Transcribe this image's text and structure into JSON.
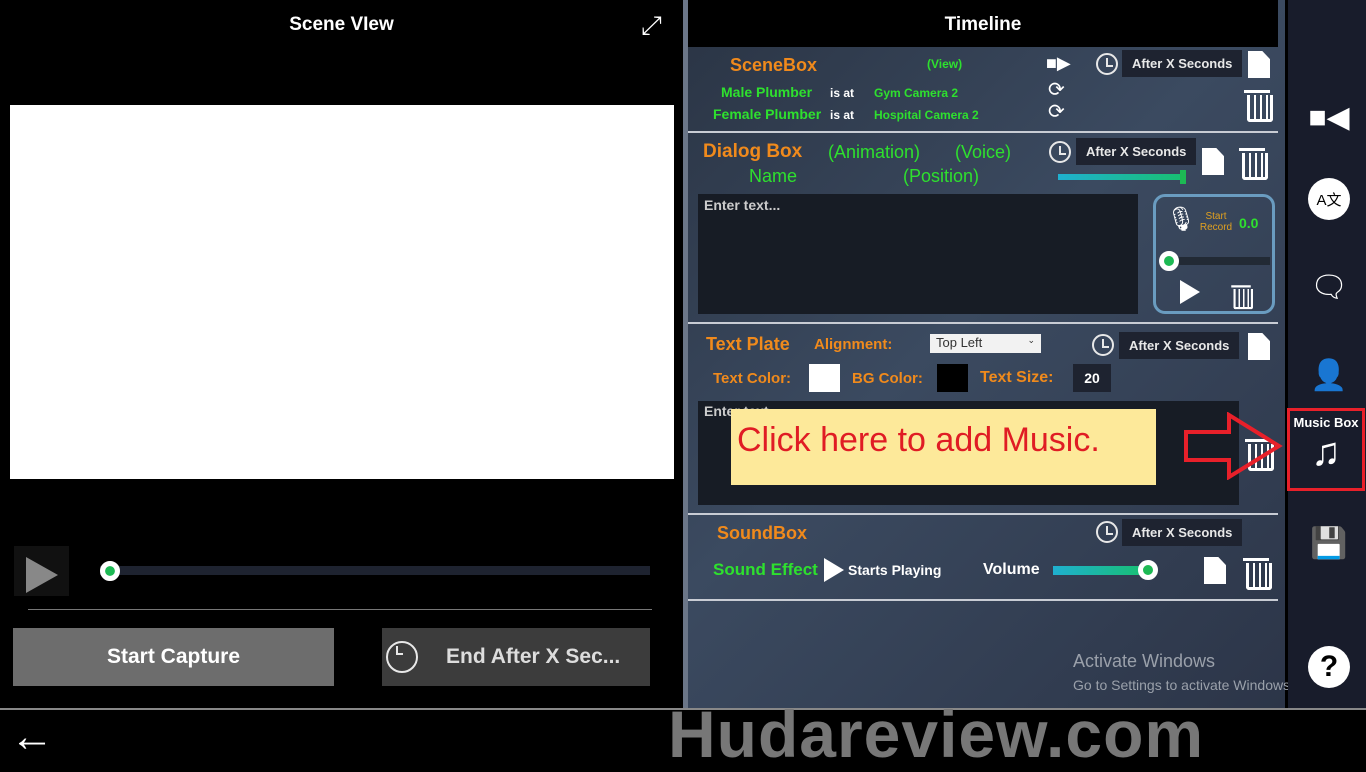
{
  "scene_view": {
    "title": "Scene VIew",
    "start_capture": "Start Capture",
    "end_after": "End After X Sec..."
  },
  "timeline": {
    "title": "Timeline",
    "scenebox": {
      "title": "SceneBox",
      "view": "(View)",
      "after": "After X Seconds",
      "rows": [
        {
          "name": "Male Plumber",
          "is_at": "is at",
          "camera": "Gym Camera 2"
        },
        {
          "name": "Female Plumber",
          "is_at": "is at",
          "camera": "Hospital Camera 2"
        }
      ]
    },
    "dialog": {
      "title": "Dialog Box",
      "animation": "(Animation)",
      "voice": "(Voice)",
      "name": "Name",
      "position": "(Position)",
      "after": "After X Seconds",
      "placeholder": "Enter text...",
      "record_label": "Start Record",
      "record_value": "0.0",
      "voice_slider": 1.0
    },
    "textplate": {
      "title": "Text Plate",
      "alignment_label": "Alignment:",
      "alignment": "Top Left",
      "after": "After X Seconds",
      "text_color_label": "Text Color:",
      "text_color": "#ffffff",
      "bg_color_label": "BG Color:",
      "bg_color": "#000000",
      "text_size_label": "Text Size:",
      "text_size": "20",
      "placeholder": "Enter text..."
    },
    "soundbox": {
      "title": "SoundBox",
      "after": "After X Seconds",
      "effect": "Sound Effect",
      "starts": "Starts Playing",
      "volume_label": "Volume",
      "volume": 0.95
    }
  },
  "sidebar": {
    "music_box_label": "Music Box",
    "items": [
      "camera-icon",
      "translate-icon",
      "dialog-icon",
      "character-chat-icon",
      "music-icon",
      "save-icon",
      "help-icon"
    ]
  },
  "callout": {
    "text": "Click here to add Music."
  },
  "watermark": {
    "activate_title": "Activate Windows",
    "activate_sub": "Go to Settings to activate Windows.",
    "site": "Hudareview.com"
  },
  "colors": {
    "accent_orange": "#f08a1c",
    "accent_green": "#2ee02e",
    "highlight_red": "#e8202a"
  }
}
